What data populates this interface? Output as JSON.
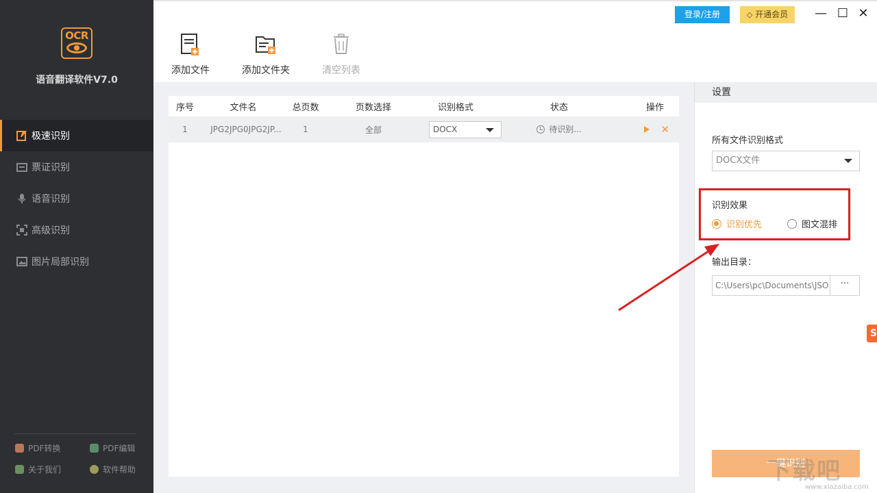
{
  "app": {
    "name": "语音翻译软件V7.0",
    "logo_text": "OCR"
  },
  "colors": {
    "accent": "#f29a38",
    "sidebar_bg": "#2e2f33",
    "login_bg": "#1ea1e8",
    "vip_bg": "#f7d466",
    "highlight_red": "#d72222"
  },
  "sidebar": {
    "items": [
      {
        "label": "极速识别",
        "icon": "lightning-edit-icon",
        "active": true
      },
      {
        "label": "票证识别",
        "icon": "id-card-icon",
        "active": false
      },
      {
        "label": "语音识别",
        "icon": "microphone-icon",
        "active": false
      },
      {
        "label": "高级识别",
        "icon": "scan-icon",
        "active": false
      },
      {
        "label": "图片局部识别",
        "icon": "image-crop-icon",
        "active": false
      }
    ],
    "footer": [
      {
        "label": "PDF转换",
        "icon": "pdf-convert-icon"
      },
      {
        "label": "PDF编辑",
        "icon": "pdf-edit-icon"
      },
      {
        "label": "关于我们",
        "icon": "chat-icon"
      },
      {
        "label": "软件帮助",
        "icon": "help-icon"
      }
    ]
  },
  "topbar": {
    "login_label": "登录/注册",
    "vip_label": "开通会员",
    "minimize": "—",
    "maximize": "☐",
    "close": "✕"
  },
  "toolbar": {
    "add_file": "添加文件",
    "add_folder": "添加文件夹",
    "clear_list": "清空列表"
  },
  "table": {
    "headers": [
      "序号",
      "文件名",
      "总页数",
      "页数选择",
      "识别格式",
      "状态",
      "操作"
    ],
    "rows": [
      {
        "index": "1",
        "filename": "JPG2JPG0JPG2JP...",
        "pages": "1",
        "page_select": "全部",
        "format": "DOCX",
        "status": "待识别..."
      }
    ]
  },
  "settings": {
    "title": "设置",
    "format_label": "所有文件识别格式",
    "format_value": "DOCX文件",
    "effect_label": "识别效果",
    "effect_options": [
      {
        "label": "识别优先",
        "selected": true
      },
      {
        "label": "图文混排",
        "selected": false
      }
    ],
    "output_label": "输出目录：",
    "output_path": "C:\\Users\\pc\\Documents\\JSO",
    "browse_label": "···",
    "start_label": "一键识别"
  },
  "watermark": {
    "text": "下载吧",
    "sub": "www.xiazaiba.com"
  }
}
